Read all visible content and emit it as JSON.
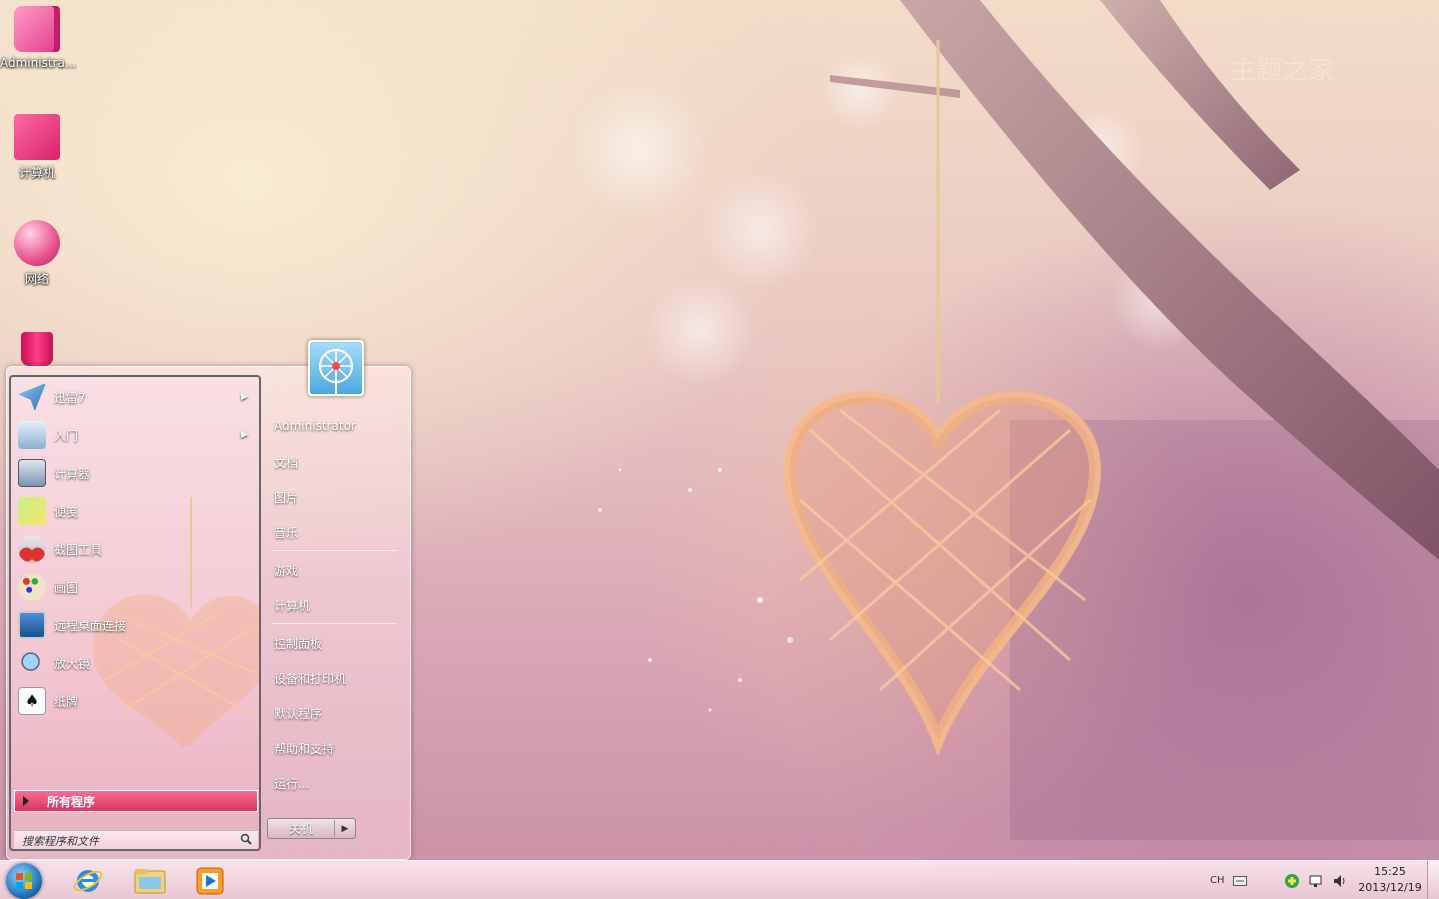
{
  "desktop": {
    "icons": [
      {
        "label": "Administra..."
      },
      {
        "label": "计算机"
      },
      {
        "label": "网络"
      },
      {
        "label": ""
      }
    ],
    "watermark": "主题之家"
  },
  "start_menu": {
    "pinned": [
      {
        "label": "迅雷7",
        "icon": "thunder-bird-icon",
        "submenu": true
      },
      {
        "label": "入门",
        "icon": "getting-started-icon",
        "submenu": true
      },
      {
        "label": "计算器",
        "icon": "calculator-icon",
        "submenu": false
      },
      {
        "label": "便笺",
        "icon": "sticky-notes-icon",
        "submenu": false
      },
      {
        "label": "截图工具",
        "icon": "scissors-icon",
        "submenu": false
      },
      {
        "label": "画图",
        "icon": "paint-palette-icon",
        "submenu": false
      },
      {
        "label": "远程桌面连接",
        "icon": "remote-desktop-icon",
        "submenu": false
      },
      {
        "label": "放大镜",
        "icon": "magnifier-icon",
        "submenu": false
      },
      {
        "label": "纸牌",
        "icon": "solitaire-icon",
        "submenu": false
      }
    ],
    "all_programs": "所有程序",
    "search_placeholder": "搜索程序和文件",
    "right": {
      "user": "Administrator",
      "documents": "文档",
      "pictures": "图片",
      "music": "音乐",
      "games": "游戏",
      "computer": "计算机",
      "control_panel": "控制面板",
      "devices": "设备和打印机",
      "default_programs": "默认程序",
      "help": "帮助和支持",
      "run": "运行..."
    },
    "shutdown": "关机"
  },
  "taskbar": {
    "language": "CH",
    "time": "15:25",
    "date": "2013/12/19"
  },
  "colors": {
    "accent": "#d8345e",
    "start_orb": "#1d6fb8"
  }
}
